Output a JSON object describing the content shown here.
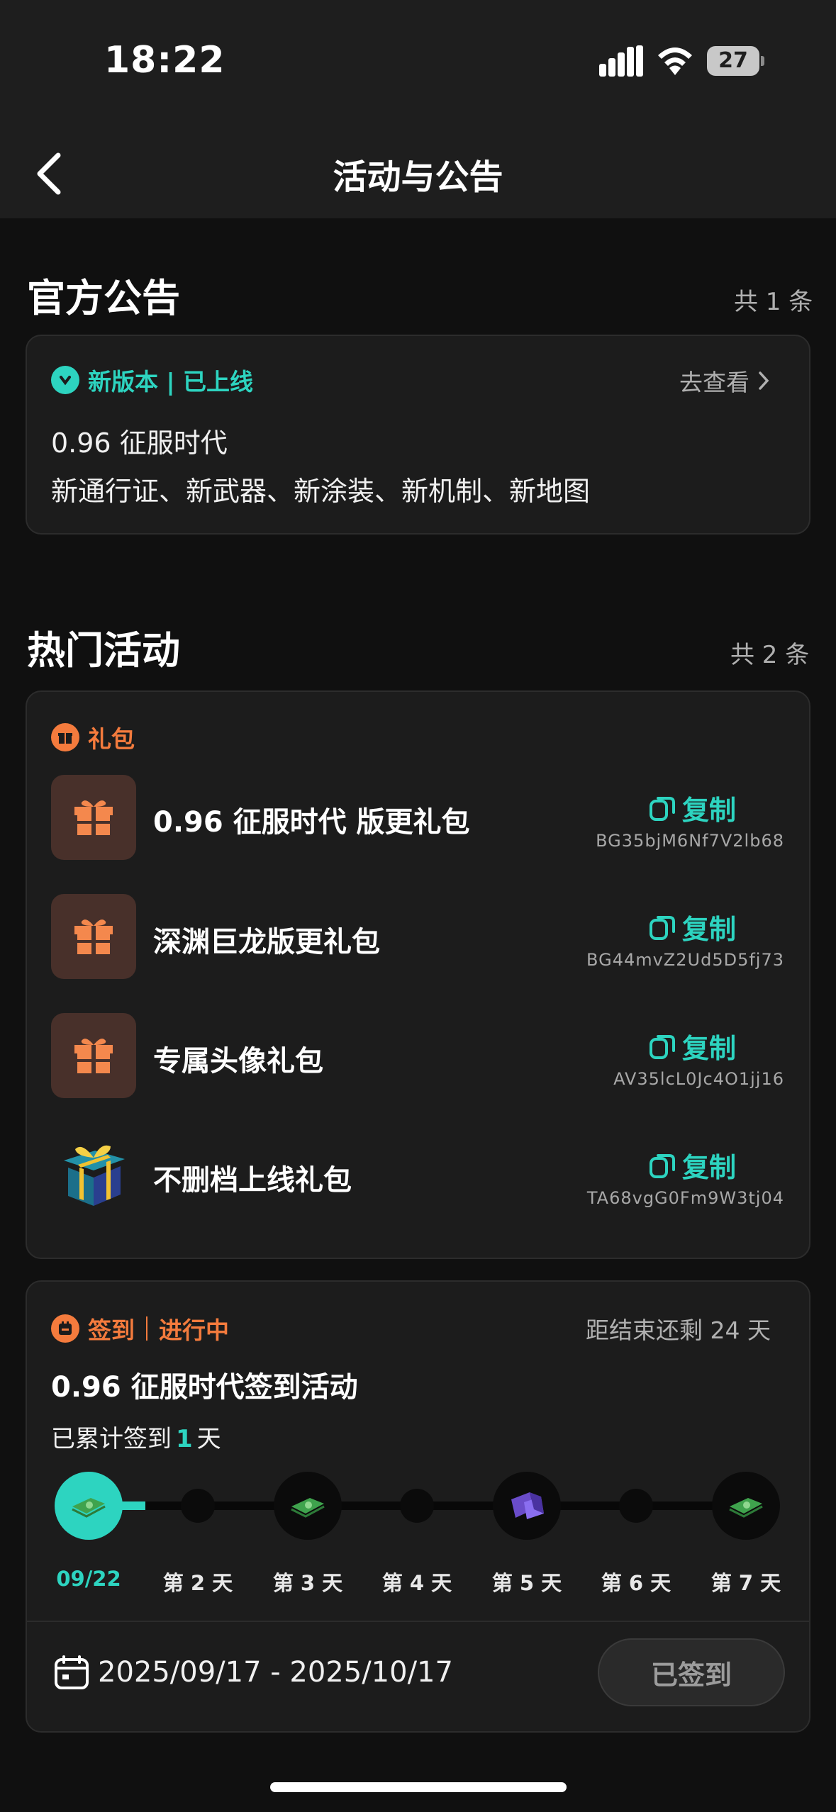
{
  "status_bar": {
    "time": "18:22",
    "battery": "27"
  },
  "nav": {
    "title": "活动与公告"
  },
  "official": {
    "title": "官方公告",
    "count": "共 1 条",
    "tag": "新版本 | 已上线",
    "link": "去查看",
    "line1": "0.96 征服时代",
    "line2": "新通行证、新武器、新涂装、新机制、新地图"
  },
  "hot": {
    "title": "热门活动",
    "count": "共 2 条",
    "gift_tag": "礼包",
    "copy_label": "复制",
    "gifts": [
      {
        "name": "0.96 征服时代 版更礼包",
        "code": "BG35bjM6Nf7V2lb68",
        "icon": "gift-icon"
      },
      {
        "name": "深渊巨龙版更礼包",
        "code": "BG44mvZ2Ud5D5fj73",
        "icon": "gift-icon"
      },
      {
        "name": "专属头像礼包",
        "code": "AV35lcL0Jc4O1jj16",
        "icon": "gift-icon"
      },
      {
        "name": "不删档上线礼包",
        "code": "TA68vgG0Fm9W3tj04",
        "icon": "gift-box-image"
      }
    ]
  },
  "signin": {
    "tag": "签到",
    "status": "进行中",
    "remaining": "距结束还剩 24 天",
    "title": "0.96 征服时代签到活动",
    "acc_prefix": "已累计签到",
    "acc_days": "1",
    "acc_suffix": "天",
    "days": [
      "09/22",
      "第 2 天",
      "第 3 天",
      "第 4 天",
      "第 5 天",
      "第 6 天",
      "第 7 天"
    ],
    "progress_days": 1,
    "date_range": "2025/09/17 - 2025/10/17",
    "button": "已签到"
  },
  "colors": {
    "accent": "#2dd4c0",
    "orange": "#f47b3d",
    "background": "#101010",
    "card": "#1c1c1c"
  }
}
